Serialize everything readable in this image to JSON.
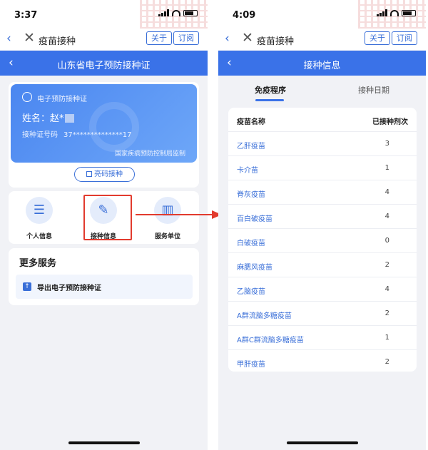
{
  "left": {
    "status": {
      "time": "3:37"
    },
    "nav": {
      "back": "‹",
      "close": "✕",
      "title": "疫苗接种",
      "about": "关于",
      "subscribe": "订阅"
    },
    "header": {
      "back": "‹",
      "title": "山东省电子预防接种证"
    },
    "card": {
      "label": "电子预防接种证",
      "name": "姓名：赵*",
      "id_label": "接种证号码",
      "id_value": "37**************17",
      "footer": "国家疾病预防控制局监制"
    },
    "qr_button": "亮码接种",
    "features": [
      {
        "label": "个人信息",
        "icon": "document-icon"
      },
      {
        "label": "接种信息",
        "icon": "syringe-icon"
      },
      {
        "label": "服务单位",
        "icon": "building-icon"
      }
    ],
    "more": {
      "title": "更多服务",
      "export_label": "导出电子预防接种证"
    }
  },
  "right": {
    "status": {
      "time": "4:09"
    },
    "nav": {
      "back": "‹",
      "close": "✕",
      "title": "疫苗接种",
      "about": "关于",
      "subscribe": "订阅"
    },
    "header": {
      "back": "‹",
      "title": "接种信息"
    },
    "tabs": [
      {
        "label": "免疫程序",
        "active": true
      },
      {
        "label": "接种日期",
        "active": false
      }
    ],
    "table": {
      "headers": [
        "疫苗名称",
        "已接种剂次"
      ],
      "rows": [
        {
          "name": "乙肝疫苗",
          "count": "3"
        },
        {
          "name": "卡介苗",
          "count": "1"
        },
        {
          "name": "脊灰疫苗",
          "count": "4"
        },
        {
          "name": "百白破疫苗",
          "count": "4"
        },
        {
          "name": "白破疫苗",
          "count": "0"
        },
        {
          "name": "麻腮风疫苗",
          "count": "2"
        },
        {
          "name": "乙脑疫苗",
          "count": "4"
        },
        {
          "name": "A群流脑多糖疫苗",
          "count": "2"
        },
        {
          "name": "A群C群流脑多糖疫苗",
          "count": "1"
        },
        {
          "name": "甲肝疫苗",
          "count": "2"
        }
      ]
    }
  },
  "colors": {
    "accent": "#3a72e8",
    "highlight": "#e23b2e",
    "background": "#f1f2f6"
  }
}
